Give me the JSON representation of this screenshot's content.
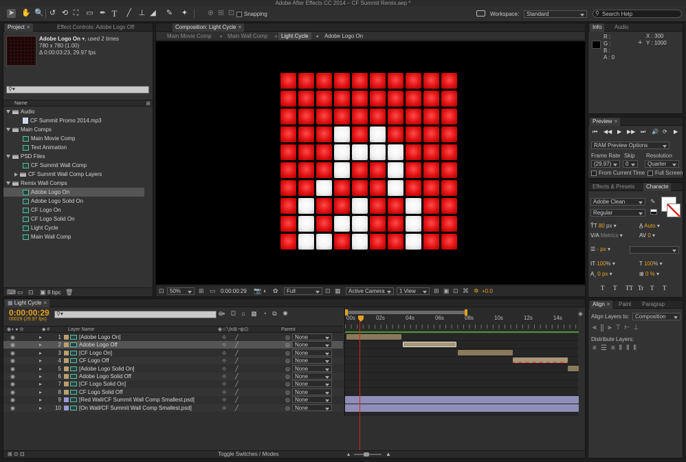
{
  "window": {
    "title": "Adobe After Effects CC 2014 – CF Summit Remix.aep *"
  },
  "toolbar": {
    "snapping_label": "Snapping",
    "workspace_label": "Workspace:",
    "workspace_value": "Standard",
    "search_placeholder": "Search Help"
  },
  "project_panel": {
    "tabs": [
      {
        "label": "Project"
      },
      {
        "label": "Effect Controls: Adobe Logo Off"
      }
    ],
    "item_name": "Adobe Logo On",
    "item_used": ", used 2 times",
    "item_size": "780 x 780 (1.00)",
    "item_duration": "Δ 0:00:03:23, 29.97 fps",
    "column_name": "Name",
    "bpc": "8 bpc",
    "tree": [
      {
        "label": "Audio",
        "type": "folder"
      },
      {
        "label": "CF Summit Promo 2014.mp3",
        "type": "audio"
      },
      {
        "label": "Main Comps",
        "type": "folder"
      },
      {
        "label": "Main Movie Comp",
        "type": "comp"
      },
      {
        "label": "Text Animation",
        "type": "comp"
      },
      {
        "label": "PSD Files",
        "type": "folder"
      },
      {
        "label": "CF Summit Wall Comp",
        "type": "comp"
      },
      {
        "label": "CF Summit Wall Comp Layers",
        "type": "folder-closed"
      },
      {
        "label": "Remix Wall Comps",
        "type": "folder"
      },
      {
        "label": "Adobe Logo On",
        "type": "comp"
      },
      {
        "label": "Adobe Logo Solid On",
        "type": "comp"
      },
      {
        "label": "CF Logo On",
        "type": "comp"
      },
      {
        "label": "CF Logo Solid On",
        "type": "comp"
      },
      {
        "label": "Light Cycle",
        "type": "comp"
      },
      {
        "label": "Main Wall Comp",
        "type": "comp"
      }
    ]
  },
  "comp_panel": {
    "tab_label": "Composition: Light Cycle",
    "breadcrumbs": [
      {
        "label": "Main Movie Comp"
      },
      {
        "label": "Main Wall Comp"
      },
      {
        "label": "Light Cycle"
      },
      {
        "label": "Adobe Logo On"
      }
    ],
    "zoom": "50%",
    "timecode": "0:00:00:29",
    "resolution": "Full",
    "camera": "Active Camera",
    "views": "1 View",
    "exposure": "+0.0",
    "white_cells": [
      [
        3,
        3
      ],
      [
        3,
        5
      ],
      [
        4,
        3
      ],
      [
        4,
        4
      ],
      [
        4,
        5
      ],
      [
        4,
        6
      ],
      [
        5,
        3
      ],
      [
        5,
        6
      ],
      [
        6,
        2
      ],
      [
        6,
        6
      ],
      [
        7,
        1
      ],
      [
        7,
        4
      ],
      [
        7,
        7
      ],
      [
        8,
        1
      ],
      [
        8,
        3
      ],
      [
        8,
        4
      ],
      [
        8,
        7
      ],
      [
        9,
        1
      ],
      [
        9,
        2
      ],
      [
        9,
        4
      ],
      [
        9,
        7
      ]
    ]
  },
  "info_panel": {
    "tabs": [
      {
        "label": "Info"
      },
      {
        "label": "Audio"
      }
    ],
    "r": "R :",
    "g": "G :",
    "b": "B :",
    "a": "A : 0",
    "x": "X : 300",
    "y": "Y : 1000"
  },
  "preview_panel": {
    "tab": "Preview",
    "ram_options": "RAM Preview Options",
    "frame_rate_label": "Frame Rate",
    "skip_label": "Skip",
    "resolution_label": "Resolution",
    "frame_rate": "(29.97)",
    "skip": "0",
    "resolution": "Quarter",
    "from_current": "From Current Time",
    "full_screen": "Full Screen"
  },
  "character_panel": {
    "tabs": [
      {
        "label": "Effects & Presets"
      },
      {
        "label": "Characte"
      }
    ],
    "font": "Adobe Clean",
    "style": "Regular",
    "size": "80",
    "size_unit": "px",
    "leading": "Auto",
    "kerning": "Metrics",
    "tracking": "0",
    "stroke": "- px",
    "vscale": "100",
    "hscale": "100",
    "pct": "%",
    "baseline": "0 px",
    "tsume": "0 %",
    "styles": [
      "T",
      "T",
      "TT",
      "Tr",
      "T",
      "T"
    ]
  },
  "align_panel": {
    "tabs": [
      {
        "label": "Align"
      },
      {
        "label": "Paint"
      },
      {
        "label": "Paragrap"
      }
    ],
    "align_to_label": "Align Layers to:",
    "align_to_value": "Composition",
    "distribute_label": "Distribute Layers:"
  },
  "timeline": {
    "tab": "Light Cycle",
    "timecode": "0:00:00:29",
    "frame_info": "00029 (29.97 fps)",
    "header_layer_name": "Layer Name",
    "header_parent": "Parent",
    "ruler": [
      "00s",
      "02s",
      "04s",
      "06s",
      "08s",
      "10s",
      "12s",
      "14s"
    ],
    "toggle_label": "Toggle Switches / Modes",
    "layers": [
      {
        "num": "1",
        "name": "[Adobe Logo On]",
        "parent": "None",
        "color": "#b8a070"
      },
      {
        "num": "2",
        "name": "Adobe Logo Off",
        "parent": "None",
        "color": "#b8a070"
      },
      {
        "num": "3",
        "name": "[CF Logo On]",
        "parent": "None",
        "color": "#b8a070"
      },
      {
        "num": "4",
        "name": "CF Logo Off",
        "parent": "None",
        "color": "#b8a070"
      },
      {
        "num": "5",
        "name": "[Adobe Logo Solid On]",
        "parent": "None",
        "color": "#b8a070"
      },
      {
        "num": "6",
        "name": "Adobe Logo Solid Off",
        "parent": "None",
        "color": "#b8a070"
      },
      {
        "num": "7",
        "name": "[CF Logo Solid On]",
        "parent": "None",
        "color": "#b8a070"
      },
      {
        "num": "8",
        "name": "CF Logo Solid Off",
        "parent": "None",
        "color": "#b8a070"
      },
      {
        "num": "9",
        "name": "[Red Wall/CF Summit Wall Comp Smallest.psd]",
        "parent": "None",
        "color": "#9a9ad8"
      },
      {
        "num": "10",
        "name": "[On Wall/CF Summit Wall Comp Smallest.psd]",
        "parent": "None",
        "color": "#9a9ad8"
      }
    ]
  }
}
